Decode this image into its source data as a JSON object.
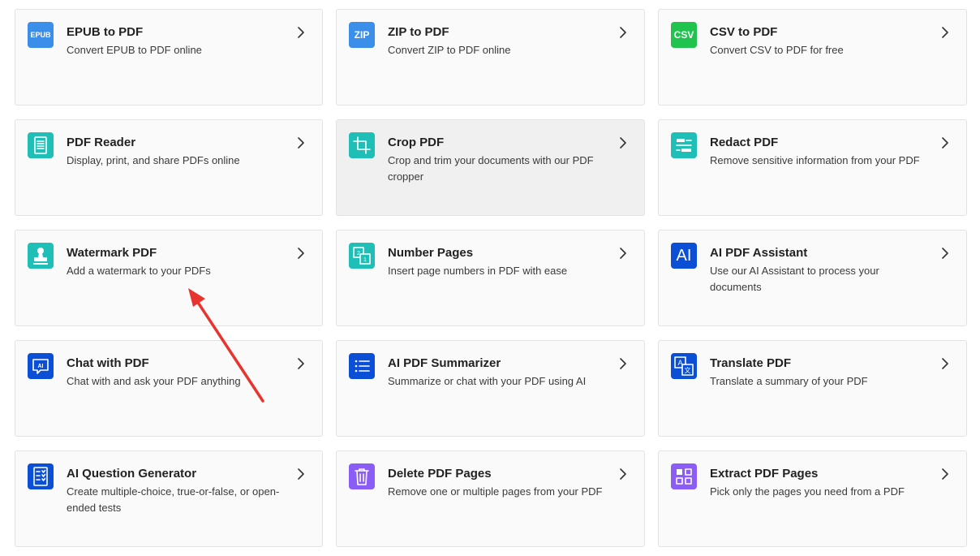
{
  "cards": [
    {
      "title": "EPUB to PDF",
      "desc": "Convert EPUB to PDF online",
      "icon": "epub-icon",
      "icon_text": "EPUB",
      "color": "#3b8eea"
    },
    {
      "title": "ZIP to PDF",
      "desc": "Convert ZIP to PDF online",
      "icon": "zip-icon",
      "icon_text": "ZIP",
      "color": "#3b8eea"
    },
    {
      "title": "CSV to PDF",
      "desc": "Convert CSV to PDF for free",
      "icon": "csv-icon",
      "icon_text": "CSV",
      "color": "#1fc34d"
    },
    {
      "title": "PDF Reader",
      "desc": "Display, print, and share PDFs online",
      "icon": "document-icon",
      "color": "#1fbfb8"
    },
    {
      "title": "Crop PDF",
      "desc": "Crop and trim your documents with our PDF cropper",
      "icon": "crop-icon",
      "color": "#1fbfb8"
    },
    {
      "title": "Redact PDF",
      "desc": "Remove sensitive information from your PDF",
      "icon": "redact-icon",
      "color": "#1fbfb8"
    },
    {
      "title": "Watermark PDF",
      "desc": "Add a watermark to your PDFs",
      "icon": "stamp-icon",
      "color": "#1fbfb8"
    },
    {
      "title": "Number Pages",
      "desc": "Insert page numbers in PDF with ease",
      "icon": "number-pages-icon",
      "color": "#1fbfb8"
    },
    {
      "title": "AI PDF Assistant",
      "desc": "Use our AI Assistant to process your documents",
      "icon": "ai-icon",
      "icon_text": "AI",
      "color": "#0a4fd6"
    },
    {
      "title": "Chat with PDF",
      "desc": "Chat with and ask your PDF anything",
      "icon": "chat-ai-icon",
      "icon_text": "AI",
      "color": "#0a4fd6"
    },
    {
      "title": "AI PDF Summarizer",
      "desc": "Summarize or chat with your PDF using AI",
      "icon": "list-icon",
      "color": "#0a4fd6"
    },
    {
      "title": "Translate PDF",
      "desc": "Translate a summary of your PDF",
      "icon": "translate-icon",
      "color": "#0a4fd6"
    },
    {
      "title": "AI Question Generator",
      "desc": "Create multiple-choice, true-or-false, or open-ended tests",
      "icon": "question-list-icon",
      "color": "#0a4fd6"
    },
    {
      "title": "Delete PDF Pages",
      "desc": "Remove one or multiple pages from your PDF",
      "icon": "trash-icon",
      "color": "#8b5cf6"
    },
    {
      "title": "Extract PDF Pages",
      "desc": "Pick only the pages you need from a PDF",
      "icon": "extract-pages-icon",
      "color": "#8b5cf6"
    }
  ],
  "hovered_card": 4,
  "annotation": {
    "type": "arrow",
    "color": "#e8342f"
  }
}
